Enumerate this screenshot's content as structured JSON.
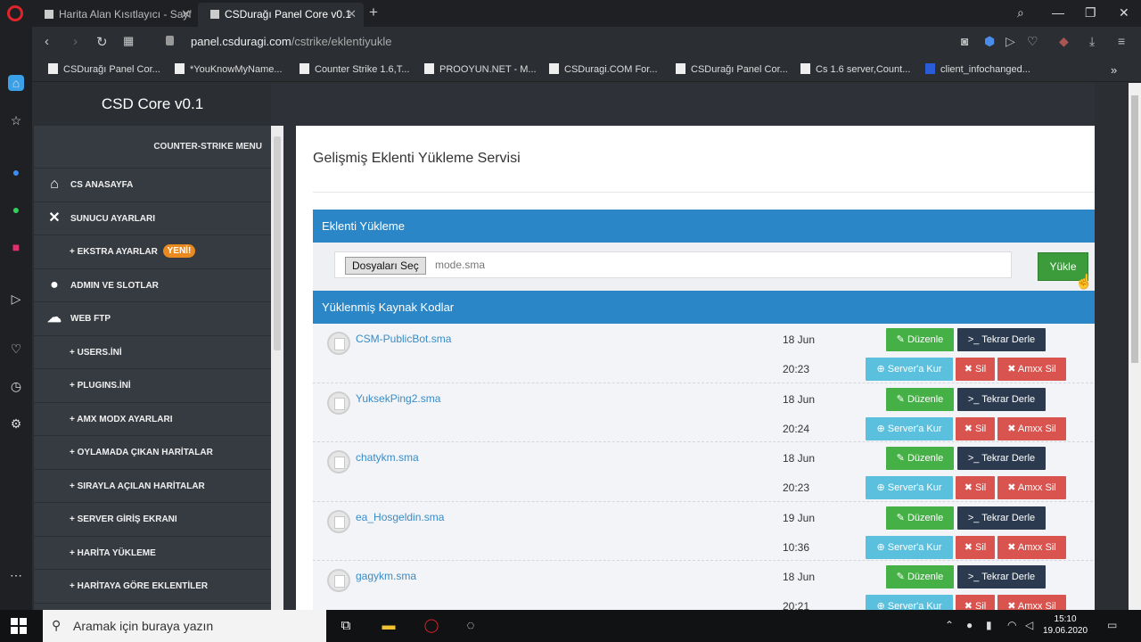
{
  "browser": {
    "tabs": [
      {
        "title": "Harita Alan Kısıtlayıcı - Sayf",
        "close": "✕"
      },
      {
        "title": "CSDurağı Panel Core v0.1",
        "close": "✕"
      }
    ],
    "new_tab": "+",
    "url_host": "panel.csduragi.com",
    "url_path": "/cstrike/eklentiyukle",
    "bookmarks": [
      "CSDurağı Panel Cor...",
      "*YouKnowMyName...",
      "Counter Strike 1.6,T...",
      "PROOYUN.NET - M...",
      "CSDuragi.COM For...",
      "CSDurağı Panel Cor...",
      "Cs 1.6 server,Count...",
      "client_infochanged..."
    ]
  },
  "panel": {
    "brand": "CSD Core v0.1",
    "menu_header": "COUNTER-STRIKE MENU",
    "nav": [
      {
        "label": "CS ANASAYFA"
      },
      {
        "label": "SUNUCU AYARLARI"
      },
      {
        "label": "EKSTRA AYARLAR",
        "badge": "YENİ!"
      },
      {
        "label": "ADMIN VE SLOTLAR"
      },
      {
        "label": "WEB FTP"
      },
      {
        "label": "USERS.İNİ"
      },
      {
        "label": "PLUGINS.İNİ"
      },
      {
        "label": "AMX MODX AYARLARI"
      },
      {
        "label": "OYLAMADA ÇIKAN HARİTALAR"
      },
      {
        "label": "SIRAYLA AÇILAN HARİTALAR"
      },
      {
        "label": "SERVER GİRİŞ EKRANI"
      },
      {
        "label": "HARİTA YÜKLEME"
      },
      {
        "label": "HARİTAYA GÖRE EKLENTİLER"
      }
    ]
  },
  "content": {
    "title": "Gelişmiş Eklenti Yükleme Servisi",
    "upload_header": "Eklenti Yükleme",
    "file_button": "Dosyaları Seç",
    "file_name": "mode.sma",
    "upload_button": "Yükle",
    "list_header": "Yüklenmiş Kaynak Kodlar",
    "buttons": {
      "edit": "✎ Düzenle",
      "compile": ">_ Tekrar Derle",
      "install": "⊕ Server'a Kur",
      "delete": "✖ Sil",
      "amxx_delete": "✖ Amxx Sil"
    },
    "files": [
      {
        "name": "CSM-PublicBot.sma",
        "date": "18 Jun",
        "time": "20:23"
      },
      {
        "name": "YuksekPing2.sma",
        "date": "18 Jun",
        "time": "20:24"
      },
      {
        "name": "chatykm.sma",
        "date": "18 Jun",
        "time": "20:23"
      },
      {
        "name": "ea_Hosgeldin.sma",
        "date": "19 Jun",
        "time": "10:36"
      },
      {
        "name": "gagykm.sma",
        "date": "18 Jun",
        "time": "20:21"
      }
    ]
  },
  "taskbar": {
    "search_placeholder": "Aramak için buraya yazın",
    "time": "15:10",
    "date": "19.06.2020"
  }
}
